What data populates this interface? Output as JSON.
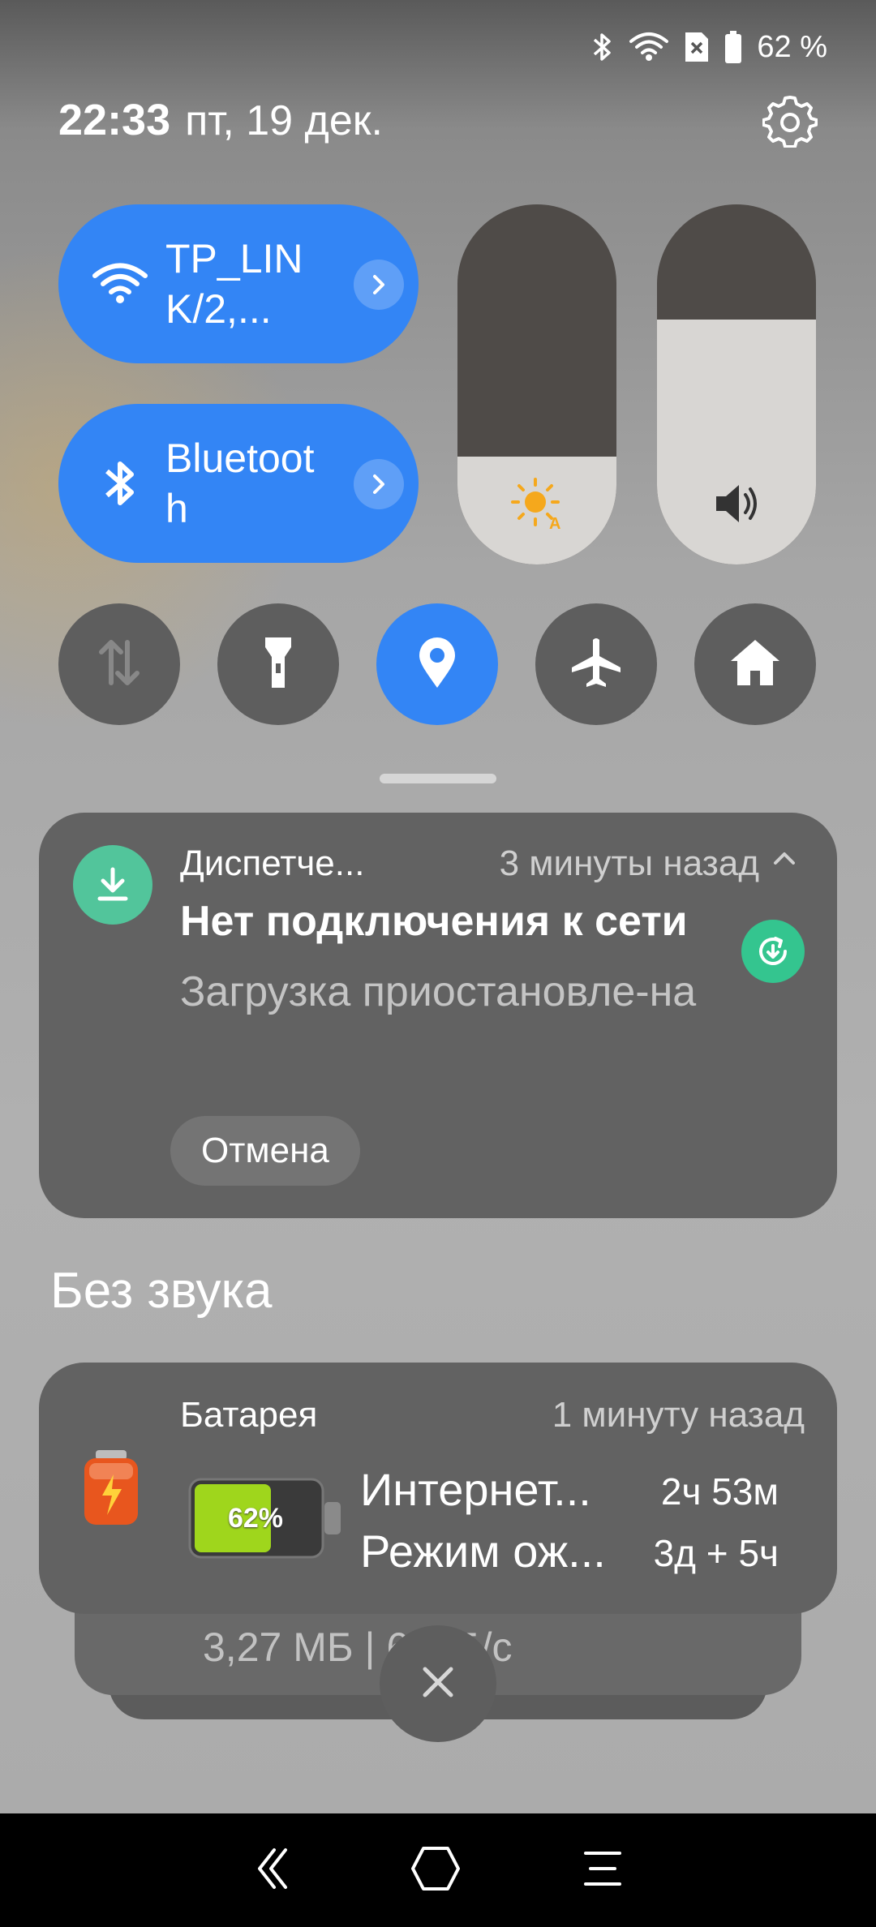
{
  "status_bar": {
    "battery_text": "62 %",
    "icons": [
      "bluetooth-icon",
      "wifi-icon",
      "sim-off-icon",
      "battery-icon"
    ]
  },
  "header": {
    "time": "22:33",
    "date": "пт, 19 дек.",
    "settings_icon": "gear-icon"
  },
  "quick_tiles": {
    "wifi": {
      "label": "TP_LINK/2,...",
      "icon": "wifi-icon",
      "active": true
    },
    "bluetooth": {
      "label": "Bluetooth",
      "icon": "bluetooth-icon",
      "active": true
    },
    "brightness_level": 0.3,
    "volume_level": 0.68,
    "round_buttons": [
      {
        "name": "mobile-data",
        "icon": "data-arrows-icon",
        "active": false
      },
      {
        "name": "flashlight",
        "icon": "flashlight-icon",
        "active": false
      },
      {
        "name": "location",
        "icon": "location-pin-icon",
        "active": true
      },
      {
        "name": "airplane-mode",
        "icon": "airplane-icon",
        "active": false
      },
      {
        "name": "home",
        "icon": "home-icon",
        "active": false
      }
    ]
  },
  "colors": {
    "accent": "#3385f5",
    "download_green": "#52c59b",
    "card_bg": "#626262"
  },
  "download_notification": {
    "app": "Диспетче...",
    "time": "3 минуты назад",
    "title": "Нет подключения к сети",
    "body": "Загрузка приостановле-на",
    "action": "Отмена"
  },
  "silent_section": {
    "title": "Без звука"
  },
  "battery_notification": {
    "app": "Батарея",
    "time": "1 минуту назад",
    "percent": "62%",
    "level": 0.62,
    "rows": [
      {
        "label": "Интернет...",
        "value": "2ч 53м"
      },
      {
        "label": "Режим ож...",
        "value": "3д + 5ч"
      }
    ]
  },
  "stacked_notification": {
    "speed": "3,27 МБ | 6,0 Б/с"
  }
}
